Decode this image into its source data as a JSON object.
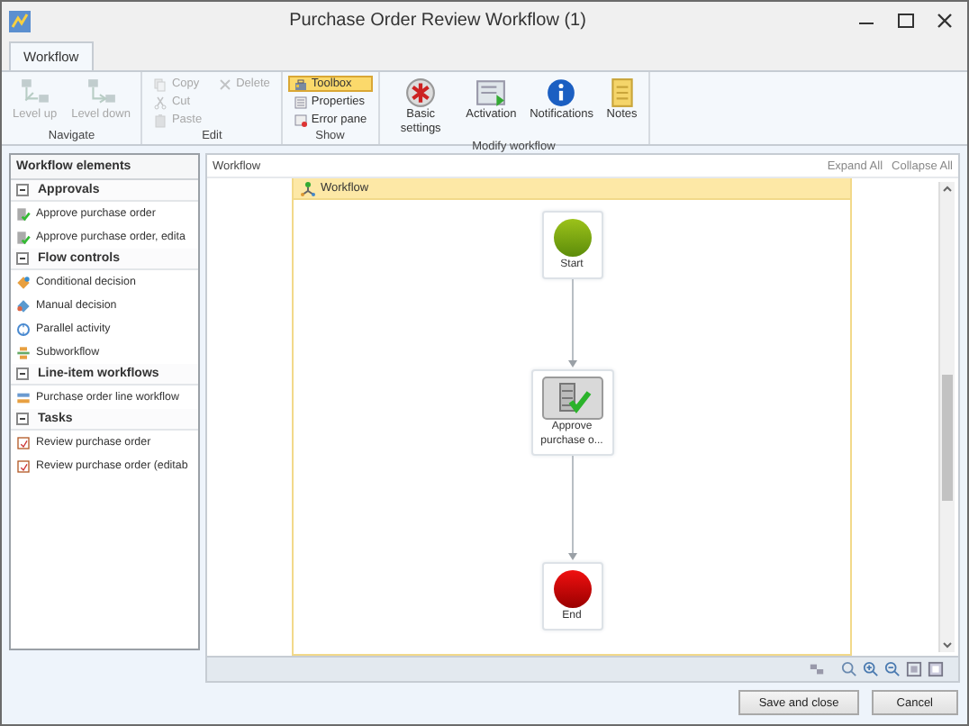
{
  "window": {
    "title": "Purchase Order Review Workflow (1)"
  },
  "ribbon": {
    "tabs": [
      {
        "label": "Workflow",
        "selected": true
      }
    ],
    "groups": [
      {
        "label": "Navigate",
        "items": [
          {
            "label": "Level up",
            "disabled": true,
            "selected": false
          },
          {
            "label": "Level down",
            "disabled": true,
            "selected": false
          }
        ]
      },
      {
        "label": "Edit",
        "items": [
          {
            "label": "Copy",
            "disabled": true,
            "selected": false
          },
          {
            "label": "Cut",
            "disabled": true,
            "selected": false
          },
          {
            "label": "Paste",
            "disabled": true,
            "selected": false
          },
          {
            "label": "Delete",
            "disabled": true,
            "selected": false
          }
        ]
      },
      {
        "label": "Show",
        "items": [
          {
            "label": "Toolbox",
            "disabled": false,
            "selected": true
          },
          {
            "label": "Properties",
            "disabled": false,
            "selected": false
          },
          {
            "label": "Error pane",
            "disabled": false,
            "selected": false
          }
        ]
      },
      {
        "label": "Modify workflow",
        "items": [
          {
            "label": "Basic settings",
            "disabled": false,
            "selected": false
          },
          {
            "label": "Activation",
            "disabled": false,
            "selected": false
          },
          {
            "label": "Notifications",
            "disabled": false,
            "selected": false
          },
          {
            "label": "Notes",
            "disabled": false,
            "selected": false
          }
        ]
      }
    ]
  },
  "sidebar": {
    "title": "Workflow elements",
    "sections": [
      {
        "label": "Approvals",
        "expanded": true,
        "items": [
          {
            "label": "Approve purchase order",
            "kind": "approval"
          },
          {
            "label": "Approve purchase order, edita",
            "kind": "approval"
          }
        ]
      },
      {
        "label": "Flow controls",
        "expanded": true,
        "items": [
          {
            "label": "Conditional decision",
            "kind": "conditional"
          },
          {
            "label": "Manual decision",
            "kind": "manual"
          },
          {
            "label": "Parallel activity",
            "kind": "parallel"
          },
          {
            "label": "Subworkflow",
            "kind": "subworkflow"
          }
        ]
      },
      {
        "label": "Line-item workflows",
        "expanded": true,
        "items": [
          {
            "label": "Purchase order line workflow",
            "kind": "line"
          }
        ]
      },
      {
        "label": "Tasks",
        "expanded": true,
        "items": [
          {
            "label": "Review purchase order",
            "kind": "task"
          },
          {
            "label": "Review purchase order (editab",
            "kind": "task"
          }
        ]
      }
    ]
  },
  "designer": {
    "title": "Workflow",
    "links": [
      "Expand All",
      "Collapse All"
    ],
    "container": "Workflow",
    "nodes": [
      {
        "label": "Start",
        "kind": "start"
      },
      {
        "label": "Approve purchase o...",
        "kind": "approval"
      },
      {
        "label": "End",
        "kind": "end"
      }
    ]
  },
  "buttons": [
    "Save and close",
    "Cancel"
  ]
}
